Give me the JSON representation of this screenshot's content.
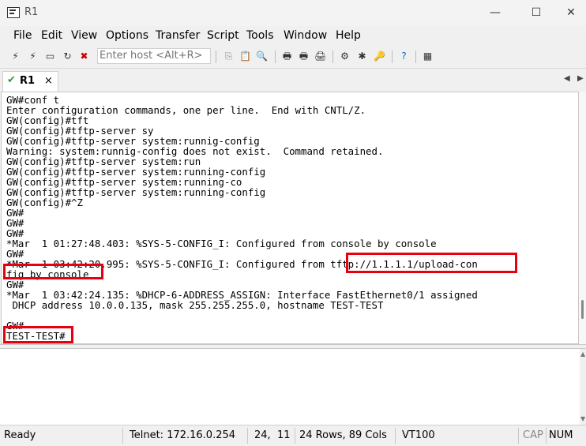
{
  "window": {
    "title": "R1",
    "minimize": "—",
    "maximize": "☐",
    "close": "✕"
  },
  "menu": [
    "File",
    "Edit",
    "View",
    "Options",
    "Transfer",
    "Script",
    "Tools",
    "Window",
    "Help"
  ],
  "toolbar": {
    "host_placeholder": "Enter host <Alt+R>"
  },
  "tab": {
    "label": "R1",
    "close": "×",
    "check": "✔",
    "nav_left": "◀",
    "nav_right": "▶"
  },
  "terminal": {
    "lines": [
      "GW#conf t",
      "Enter configuration commands, one per line.  End with CNTL/Z.",
      "GW(config)#tft",
      "GW(config)#tftp-server sy",
      "GW(config)#tftp-server system:runnig-config",
      "Warning: system:runnig-config does not exist.  Command retained.",
      "GW(config)#tftp-server system:run",
      "GW(config)#tftp-server system:running-config",
      "GW(config)#tftp-server system:running-co",
      "GW(config)#tftp-server system:running-config",
      "GW(config)#^Z",
      "GW#",
      "GW#",
      "GW#",
      "*Mar  1 01:27:48.403: %SYS-5-CONFIG_I: Configured from console by console",
      "GW#",
      "*Mar  1 03:42:20.995: %SYS-5-CONFIG_I: Configured from tftp://1.1.1.1/upload-con",
      "fig by console",
      "GW#",
      "*Mar  1 03:42:24.135: %DHCP-6-ADDRESS_ASSIGN: Interface FastEthernet0/1 assigned",
      " DHCP address 10.0.0.135, mask 255.255.255.0, hostname TEST-TEST",
      "",
      "GW#",
      "TEST-TEST#"
    ]
  },
  "status": {
    "ready": "Ready",
    "connection": "Telnet: 172.16.0.254",
    "cursor": "24,  11",
    "size": "24 Rows, 89 Cols",
    "emulation": "VT100",
    "cap": "CAP",
    "num": "NUM"
  },
  "colors": {
    "highlight": "#e8000f",
    "check": "#2e9e3c"
  }
}
